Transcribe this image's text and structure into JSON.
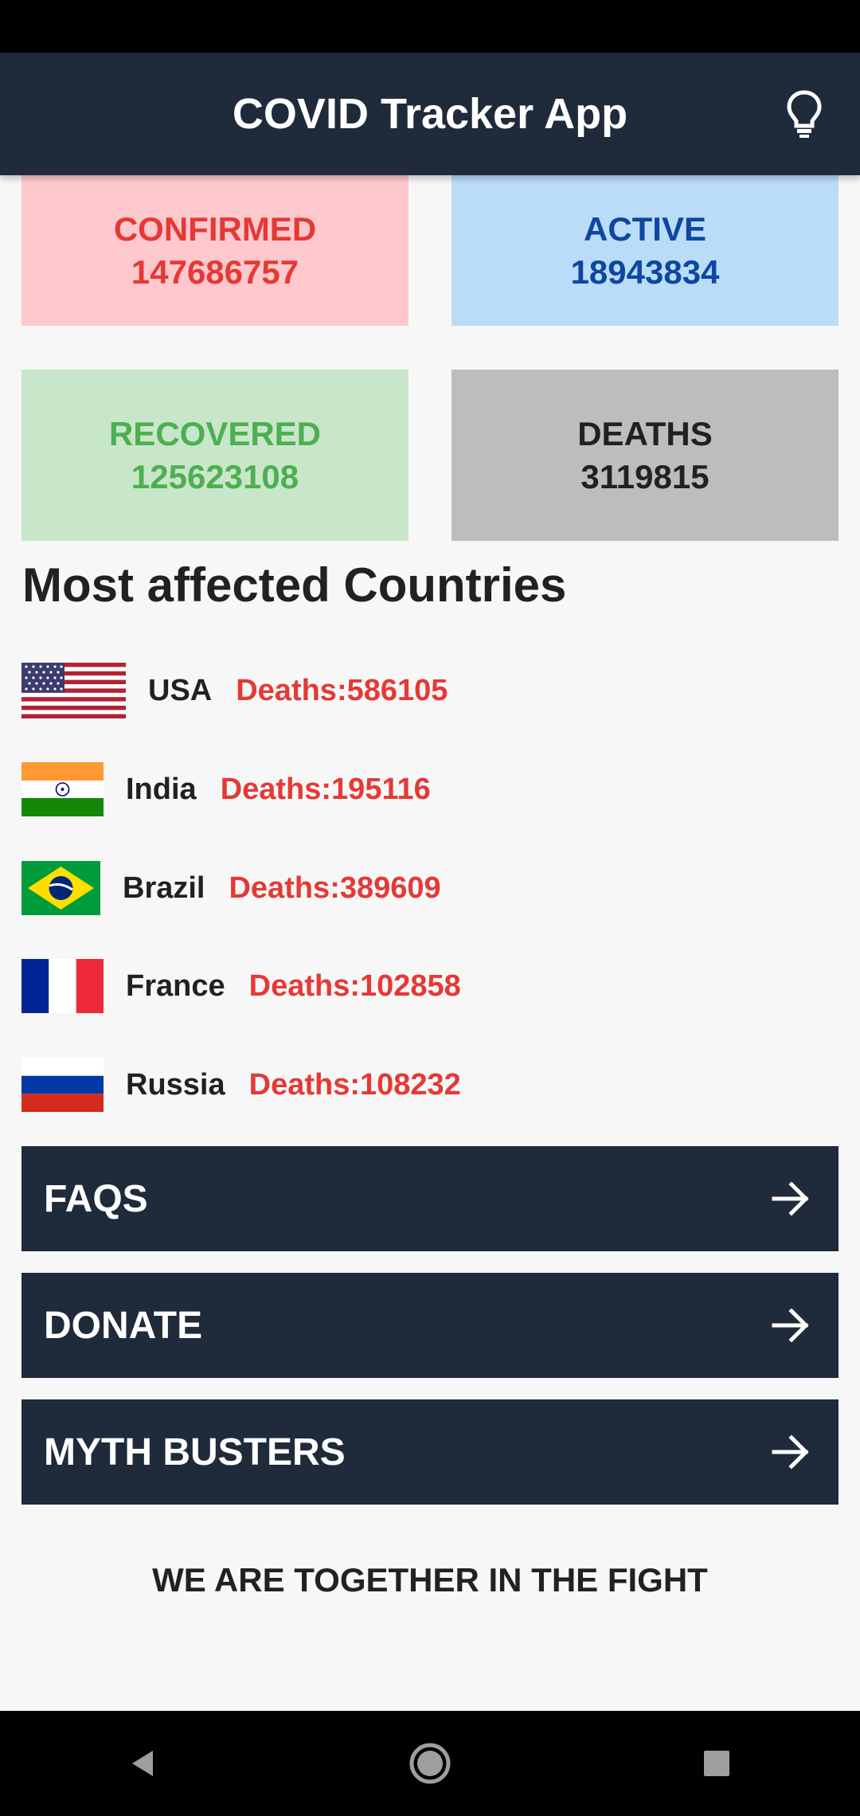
{
  "app_bar": {
    "title": "COVID Tracker App",
    "theme_icon": "lightbulb-icon"
  },
  "stats": {
    "confirmed": {
      "label": "CONFIRMED",
      "value": "147686757",
      "bg": "#ffc8cd",
      "color": "#e53935"
    },
    "active": {
      "label": "ACTIVE",
      "value": "18943834",
      "bg": "#bbdcf8",
      "color": "#0d47a1"
    },
    "recovered": {
      "label": "RECOVERED",
      "value": "125623108",
      "bg": "#c8e6c9",
      "color": "#4caf50"
    },
    "deaths": {
      "label": "DEATHS",
      "value": "3119815",
      "bg": "#bdbdbd",
      "color": "#212121"
    }
  },
  "section_title": "Most affected Countries",
  "countries": [
    {
      "name": "USA",
      "deaths": "Deaths:586105",
      "flag": "usa-flag-icon"
    },
    {
      "name": "India",
      "deaths": "Deaths:195116",
      "flag": "india-flag-icon"
    },
    {
      "name": "Brazil",
      "deaths": "Deaths:389609",
      "flag": "brazil-flag-icon"
    },
    {
      "name": "France",
      "deaths": "Deaths:102858",
      "flag": "france-flag-icon"
    },
    {
      "name": "Russia",
      "deaths": "Deaths:108232",
      "flag": "russia-flag-icon"
    }
  ],
  "nav_buttons": [
    {
      "label": "FAQS",
      "icon": "arrow-right-icon"
    },
    {
      "label": "DONATE",
      "icon": "arrow-right-icon"
    },
    {
      "label": "MYTH BUSTERS",
      "icon": "arrow-right-icon"
    }
  ],
  "footer_text": "WE ARE TOGETHER IN THE FIGHT",
  "system_nav": {
    "back_icon": "back-triangle-icon",
    "home_icon": "home-circle-icon",
    "recents_icon": "recents-square-icon"
  },
  "colors": {
    "primary": "#1f2a3b",
    "deaths_text": "#e53935",
    "background": "#f7f7f7"
  }
}
